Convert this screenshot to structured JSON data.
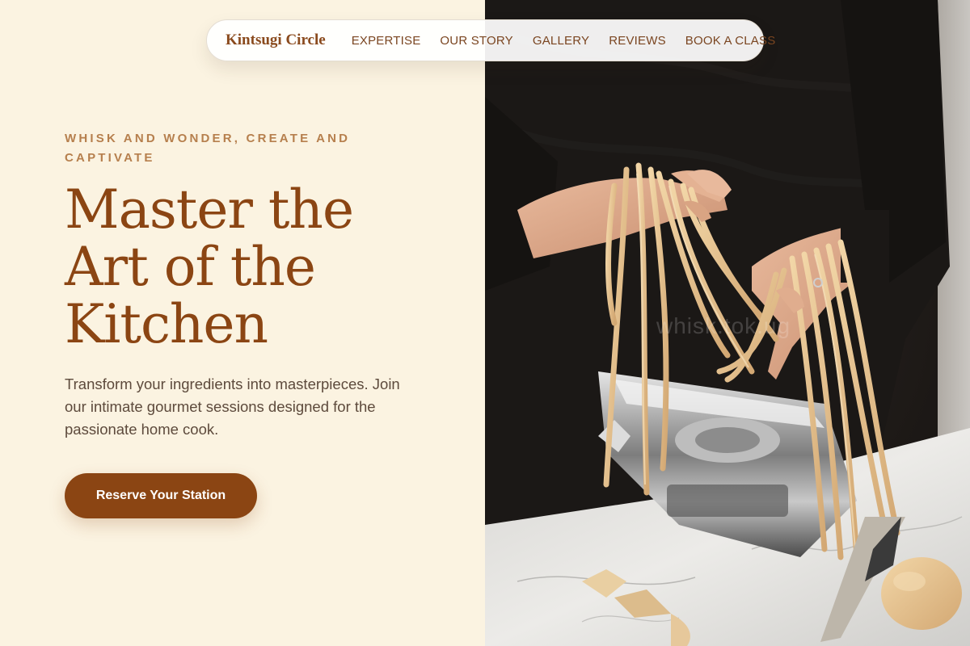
{
  "nav": {
    "brand": "Kintsugi Circle",
    "links": [
      "EXPERTISE",
      "OUR STORY",
      "GALLERY",
      "REVIEWS",
      "BOOK A CLASS"
    ]
  },
  "hero": {
    "eyebrow": "WHISK AND WONDER, CREATE AND CAPTIVATE",
    "headline": [
      "Master the",
      "Art of the",
      "Kitchen"
    ],
    "subtitle": "Transform your ingredients into masterpieces. Join our intimate gourmet sessions designed for the passionate home cook.",
    "cta_label": "Reserve Your Station"
  },
  "photo": {
    "watermark": "whisk.tok.ug"
  },
  "colors": {
    "background": "#fbf3e1",
    "accent": "#8b4513",
    "eyebrow": "#b67f4d",
    "body_text": "#5d4a3c"
  }
}
